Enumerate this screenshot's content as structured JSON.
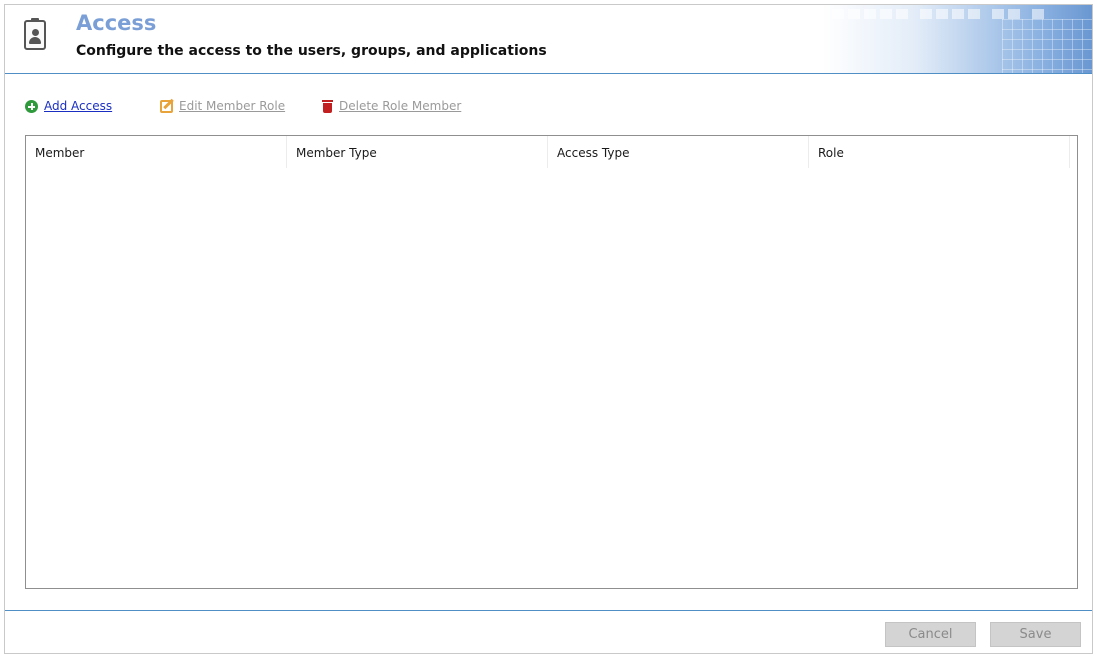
{
  "header": {
    "title": "Access",
    "subtitle": "Configure the access to the users, groups, and applications",
    "icon": "id-badge-icon"
  },
  "toolbar": {
    "add_label": "Add Access",
    "edit_label": "Edit Member Role",
    "delete_label": "Delete Role Member",
    "add_icon": "plus-circle-icon",
    "edit_icon": "edit-icon",
    "delete_icon": "trash-icon"
  },
  "grid": {
    "columns": [
      "Member",
      "Member Type",
      "Access Type",
      "Role"
    ],
    "rows": []
  },
  "footer": {
    "cancel_label": "Cancel",
    "save_label": "Save"
  },
  "colors": {
    "title": "#7a9fd6",
    "accent_line": "#4f8fc5",
    "add_link": "#1a2fc2",
    "add_icon": "#2e9a3c",
    "edit_icon": "#e8a33b",
    "delete_icon": "#c22020",
    "disabled_text": "#9a9a9a"
  }
}
